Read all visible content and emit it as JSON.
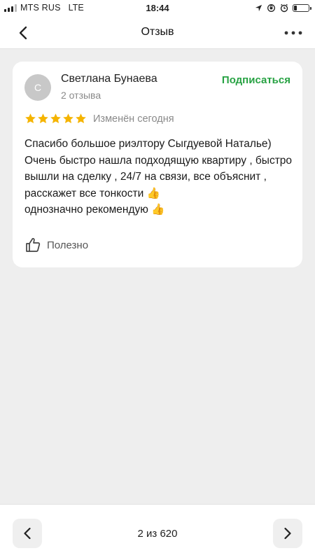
{
  "status_bar": {
    "carrier": "MTS RUS",
    "network": "LTE",
    "time": "18:44",
    "signal_bars_filled": 3,
    "signal_bars_total": 4,
    "battery_level": 0.2
  },
  "nav": {
    "title": "Отзыв",
    "back_icon": "chevron-left-icon",
    "more_icon": "more-horizontal-icon"
  },
  "review": {
    "avatar_letter": "С",
    "author_name": "Светлана Бунаева",
    "author_reviews": "2 отзыва",
    "subscribe_label": "Подписаться",
    "rating": 5,
    "rating_max": 5,
    "edited_label": "Изменён сегодня",
    "text_lines": [
      "Спасибо большое риэлтору Сыгдуевой Наталье)",
      "Очень быстро нашла подходящую квартиру , быстро вышли на сделку , 24/7 на связи, все объяснит , расскажет все тонкости 👍",
      "однозначно рекомендую 👍"
    ],
    "helpful_label": "Полезно"
  },
  "pager": {
    "counter": "2 из 620"
  },
  "colors": {
    "accent_green": "#27a243",
    "star_yellow": "#f5b400",
    "background": "#eeeeee",
    "card": "#ffffff",
    "muted_text": "#8a8a8a"
  }
}
